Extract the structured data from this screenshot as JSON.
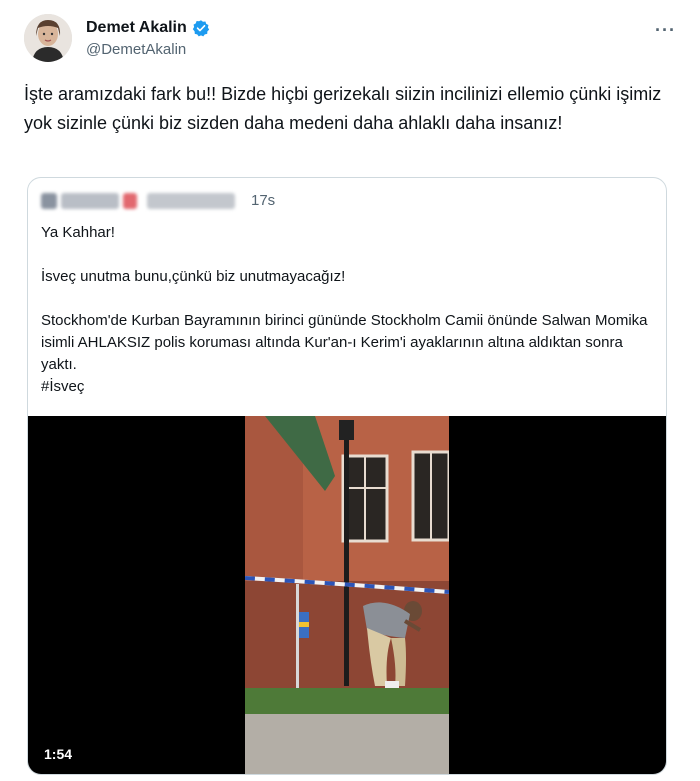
{
  "author": {
    "display_name": "Demet Akalin",
    "handle": "@DemetAkalin",
    "avatar_icon": "avatar",
    "verified_icon": "verified-badge-icon",
    "verified_color": "#1d9bf0"
  },
  "more_label": "···",
  "tweet": {
    "text": "İşte aramızdaki fark bu!! Bizde hiçbi gerizekalı siizin incilinizi ellemio çünki işimiz yok sizinle çünki biz sizden daha medeni daha ahlaklı daha insanız!"
  },
  "quote": {
    "time": "17s",
    "text": "Ya Kahhar!\n\nİsveç unutma bunu,çünkü biz unutmayacağız!\n\nStockhom'de Kurban Bayramının birinci gününde Stockholm Camii önünde Salwan Momika isimli AHLAKSIZ polis koruması altında Kur'an-ı Kerim'i ayaklarının altına aldıktan sonra yaktı.\n#İsveç",
    "video_duration": "1:54"
  },
  "colors": {
    "text_primary": "#0f1419",
    "text_secondary": "#536471",
    "border": "#cfd9de",
    "media_bg": "#000000"
  }
}
